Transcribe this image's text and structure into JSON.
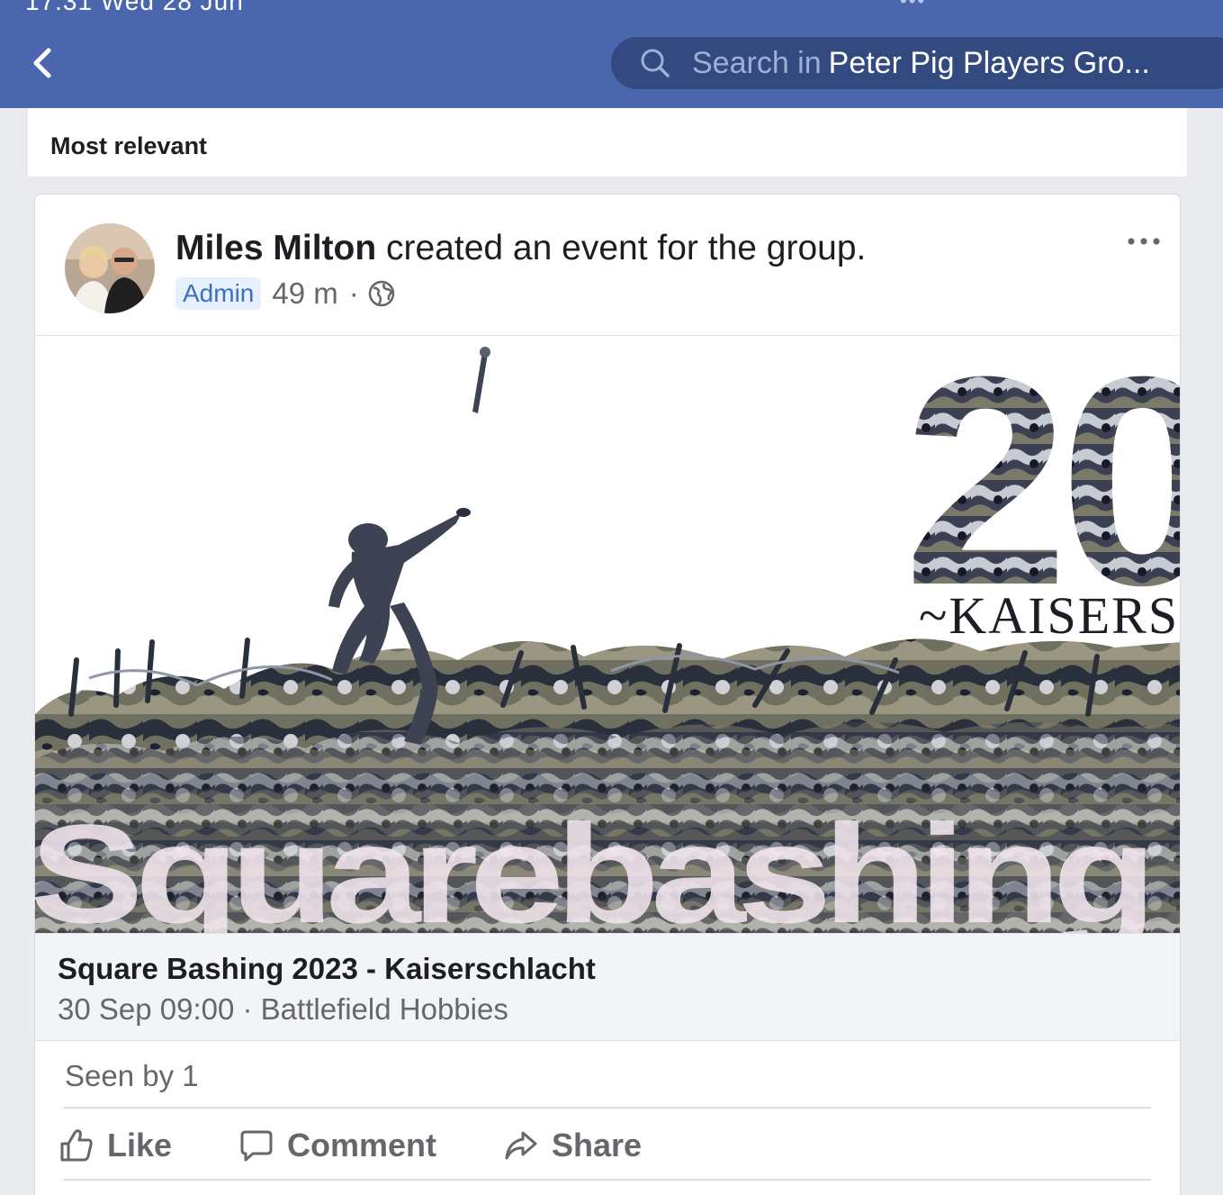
{
  "status": {
    "time_date_partial": "17:31  Wed 28 Jun",
    "dots": "•••"
  },
  "header": {
    "search_prefix": "Search in",
    "search_group": "Peter Pig Players Gro..."
  },
  "sort": {
    "label": "Most relevant"
  },
  "post": {
    "author": "Miles Milton",
    "action_text": " created an event for the group.",
    "badge": "Admin",
    "time": "49 m",
    "separator": "·",
    "privacy_icon": "globe-icon",
    "more_icon": "more-icon"
  },
  "event": {
    "image_text": {
      "big_number": "20",
      "subtitle": "~KAISERS",
      "overlay": "Squarebashing"
    },
    "title": "Square Bashing 2023 - Kaiserschlacht",
    "subtitle": "30 Sep 09:00 · Battlefield Hobbies"
  },
  "footer": {
    "seen": "Seen by 1",
    "like": "Like",
    "comment": "Comment",
    "share": "Share"
  },
  "colors": {
    "brand": "#4a66ad",
    "search_bg": "#334a80",
    "admin_bg": "#e7f0fd",
    "admin_text": "#3b6fc2"
  }
}
